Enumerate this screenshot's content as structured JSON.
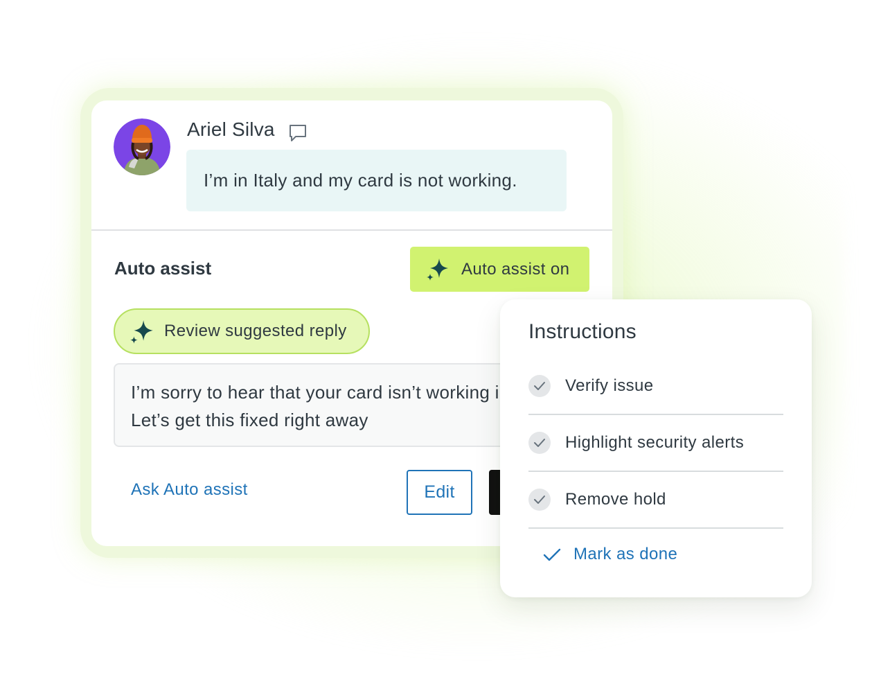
{
  "ticket": {
    "customer_name": "Ariel Silva",
    "message": "I’m in Italy and my card is not working."
  },
  "auto_assist": {
    "section_title": "Auto assist",
    "toggle_label": "Auto assist on",
    "review_label": "Review suggested reply",
    "suggested_reply": "I’m sorry to hear that your card isn’t working in Italy. Let’s get this fixed right away",
    "ask_link": "Ask Auto assist",
    "edit_label": "Edit"
  },
  "instructions": {
    "title": "Instructions",
    "steps": [
      {
        "label": "Verify issue"
      },
      {
        "label": "Highlight security alerts"
      },
      {
        "label": "Remove hold"
      }
    ],
    "mark_done_label": "Mark as done"
  },
  "icons": {
    "chat": "speech-bubble-icon",
    "sparkle": "sparkle-icon",
    "check": "checkmark-icon"
  },
  "colors": {
    "accent_green": "#d1f270",
    "pill_green": "#e6f8b8",
    "message_bubble": "#e9f6f6",
    "link_blue": "#1f73b7",
    "text_dark": "#2f3941"
  }
}
